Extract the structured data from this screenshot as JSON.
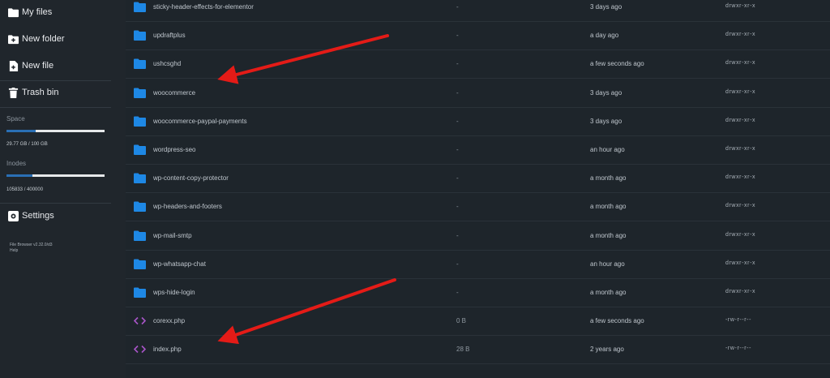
{
  "sidebar": {
    "nav": [
      {
        "label": "My files",
        "icon": "folder-icon"
      },
      {
        "label": "New folder",
        "icon": "new-folder-icon"
      },
      {
        "label": "New file",
        "icon": "new-file-icon"
      },
      {
        "label": "Trash bin",
        "icon": "trash-icon"
      }
    ],
    "space": {
      "label": "Space",
      "value": "29.77 GB / 100 GB",
      "fraction": 0.2977
    },
    "inodes": {
      "label": "Inodes",
      "value": "105833 / 400000",
      "fraction": 0.2646
    },
    "settings": {
      "label": "Settings",
      "icon": "gear-icon"
    },
    "footer": {
      "version": "File Browser v2.32.0/d3",
      "help": "Help"
    }
  },
  "files": [
    {
      "name": "sticky-header-effects-for-elementor",
      "size": "-",
      "modified": "3 days ago",
      "perm": "drwxr-xr-x",
      "type": "folder"
    },
    {
      "name": "updraftplus",
      "size": "-",
      "modified": "a day ago",
      "perm": "drwxr-xr-x",
      "type": "folder"
    },
    {
      "name": "ushcsghd",
      "size": "-",
      "modified": "a few seconds ago",
      "perm": "drwxr-xr-x",
      "type": "folder"
    },
    {
      "name": "woocommerce",
      "size": "-",
      "modified": "3 days ago",
      "perm": "drwxr-xr-x",
      "type": "folder"
    },
    {
      "name": "woocommerce-paypal-payments",
      "size": "-",
      "modified": "3 days ago",
      "perm": "drwxr-xr-x",
      "type": "folder"
    },
    {
      "name": "wordpress-seo",
      "size": "-",
      "modified": "an hour ago",
      "perm": "drwxr-xr-x",
      "type": "folder"
    },
    {
      "name": "wp-content-copy-protector",
      "size": "-",
      "modified": "a month ago",
      "perm": "drwxr-xr-x",
      "type": "folder"
    },
    {
      "name": "wp-headers-and-footers",
      "size": "-",
      "modified": "a month ago",
      "perm": "drwxr-xr-x",
      "type": "folder"
    },
    {
      "name": "wp-mail-smtp",
      "size": "-",
      "modified": "a month ago",
      "perm": "drwxr-xr-x",
      "type": "folder"
    },
    {
      "name": "wp-whatsapp-chat",
      "size": "-",
      "modified": "an hour ago",
      "perm": "drwxr-xr-x",
      "type": "folder"
    },
    {
      "name": "wps-hide-login",
      "size": "-",
      "modified": "a month ago",
      "perm": "drwxr-xr-x",
      "type": "folder"
    },
    {
      "name": "corexx.php",
      "size": "0 B",
      "modified": "a few seconds ago",
      "perm": "-rw-r--r--",
      "type": "code"
    },
    {
      "name": "index.php",
      "size": "28 B",
      "modified": "2 years ago",
      "perm": "-rw-r--r--",
      "type": "code"
    }
  ],
  "colors": {
    "folder": "#1e88e5",
    "code": "#a855c8",
    "arrow": "#e41b17",
    "meter_fill": "#2a6fb5"
  }
}
